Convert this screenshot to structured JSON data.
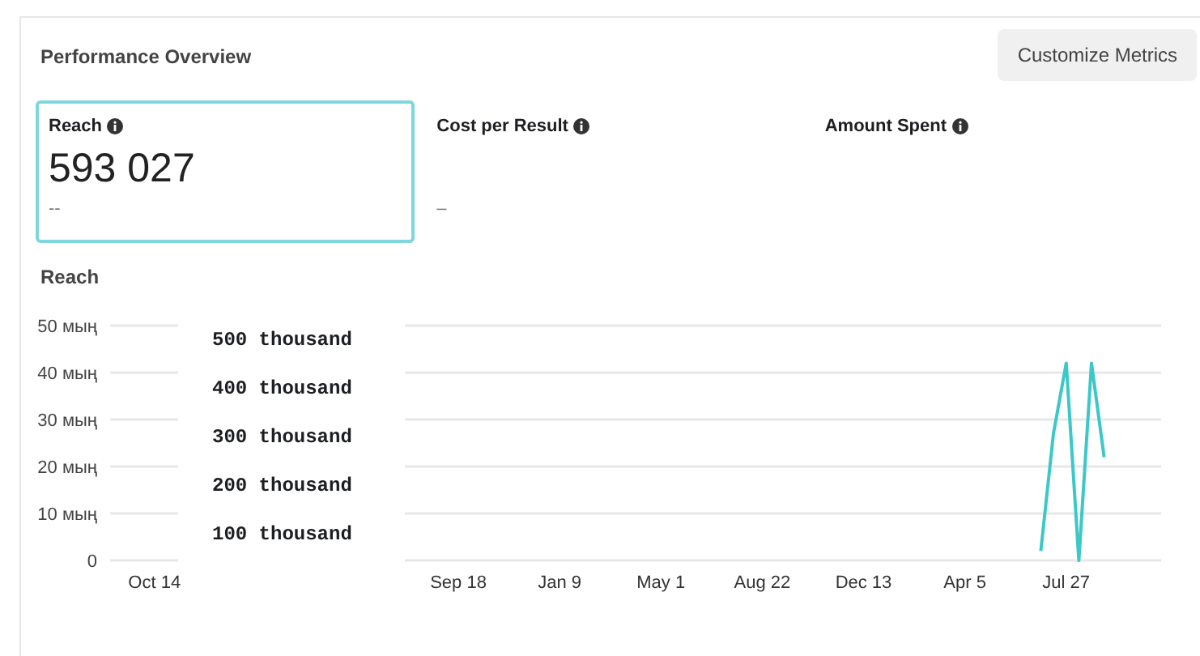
{
  "title": "Performance Overview",
  "customize_button": "Customize Metrics",
  "metrics": [
    {
      "label": "Reach",
      "value": "593 027",
      "sub": "--",
      "selected": true
    },
    {
      "label": "Cost per Result",
      "sub": "–",
      "selected": false
    },
    {
      "label": "Amount Spent",
      "selected": false
    }
  ],
  "chart_title": "Reach",
  "chart_data": {
    "type": "line",
    "grid": true,
    "ylim": [
      0,
      50
    ],
    "categories": [
      null,
      null,
      null,
      "Oct 14",
      null,
      null,
      null,
      null,
      null,
      null,
      null,
      null,
      null,
      null,
      null,
      null,
      null,
      null,
      null,
      null,
      null,
      null,
      null,
      null,
      null,
      null,
      null,
      "Sep 18",
      null,
      null,
      null,
      null,
      null,
      null,
      null,
      "Jan 9",
      null,
      null,
      null,
      null,
      null,
      null,
      null,
      "May 1",
      null,
      null,
      null,
      null,
      null,
      null,
      null,
      "Aug 22",
      null,
      null,
      null,
      null,
      null,
      null,
      null,
      "Dec 13",
      null,
      null,
      null,
      null,
      null,
      null,
      null,
      "Apr 5",
      null,
      null,
      null,
      null,
      null,
      null,
      null,
      "Jul 27",
      null,
      null,
      null,
      null,
      null,
      null,
      null
    ],
    "yticks": [
      {
        "value": 0,
        "label": "0"
      },
      {
        "value": 10,
        "label": "10 мың"
      },
      {
        "value": 20,
        "label": "20 мың"
      },
      {
        "value": 30,
        "label": "30 мың"
      },
      {
        "value": 40,
        "label": "40 мың"
      },
      {
        "value": 50,
        "label": "50 мың"
      }
    ],
    "series": [
      {
        "color": "#3cc8c8",
        "values": [
          null,
          null,
          null,
          null,
          null,
          null,
          null,
          null,
          null,
          null,
          null,
          null,
          null,
          null,
          null,
          null,
          null,
          null,
          null,
          null,
          null,
          null,
          null,
          null,
          null,
          null,
          null,
          null,
          null,
          null,
          null,
          null,
          null,
          null,
          null,
          null,
          null,
          null,
          null,
          null,
          null,
          null,
          null,
          null,
          null,
          null,
          null,
          null,
          null,
          null,
          null,
          null,
          null,
          null,
          null,
          null,
          null,
          null,
          null,
          null,
          null,
          null,
          null,
          null,
          null,
          null,
          null,
          null,
          null,
          null,
          null,
          null,
          null,
          2,
          27,
          42,
          0,
          42,
          22,
          null,
          null,
          null,
          null
        ]
      }
    ]
  },
  "overlay_labels": [
    "500 thousand",
    "400 thousand",
    "300 thousand",
    "200 thousand",
    "100 thousand"
  ]
}
